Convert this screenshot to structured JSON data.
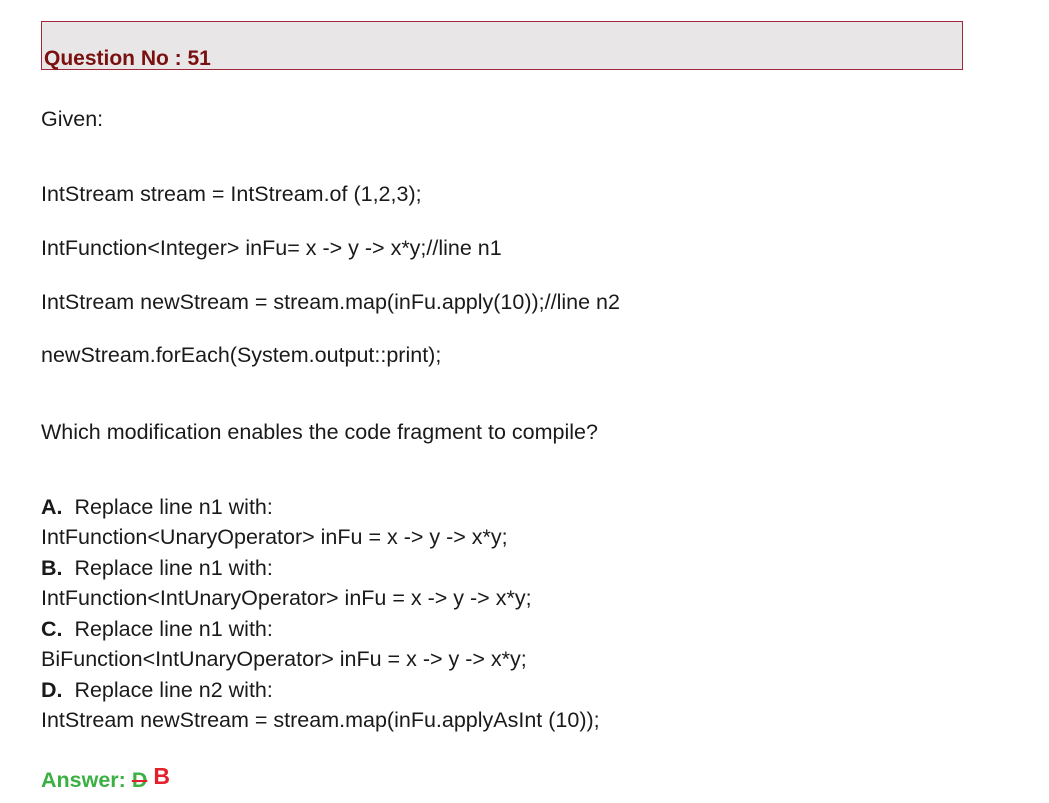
{
  "header": {
    "title": "Question No : 51"
  },
  "question": {
    "intro": "Given:",
    "code": [
      "IntStream stream = IntStream.of (1,2,3);",
      "IntFunction<Integer> inFu= x -> y -> x*y;//line n1",
      "IntStream newStream = stream.map(inFu.apply(10));//line n2",
      "newStream.forEach(System.output::print);"
    ],
    "prompt": "Which modification enables the code fragment to compile?"
  },
  "options": [
    {
      "letter": "A.",
      "text": "Replace line n1 with:",
      "code": "IntFunction<UnaryOperator> inFu = x -> y -> x*y;"
    },
    {
      "letter": "B.",
      "text": "Replace line n1 with:",
      "code": "IntFunction<IntUnaryOperator> inFu = x -> y -> x*y;"
    },
    {
      "letter": "C.",
      "text": "Replace line n1 with:",
      "code": "BiFunction<IntUnaryOperator> inFu = x -> y -> x*y;"
    },
    {
      "letter": "D.",
      "text": "Replace line n2 with:",
      "code": "IntStream newStream = stream.map(inFu.applyAsInt (10));"
    }
  ],
  "answer": {
    "label": "Answer:",
    "original": "D",
    "corrected": "B"
  }
}
